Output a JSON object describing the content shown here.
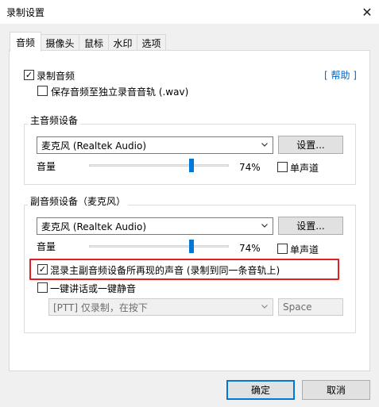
{
  "window": {
    "title": "录制设置",
    "close_glyph": "✕"
  },
  "tabs": [
    {
      "label": "音频",
      "active": true
    },
    {
      "label": "摄像头",
      "active": false
    },
    {
      "label": "鼠标",
      "active": false
    },
    {
      "label": "水印",
      "active": false
    },
    {
      "label": "选项",
      "active": false
    }
  ],
  "audio": {
    "record_audio": {
      "label": "录制音频",
      "checked": true
    },
    "help_link": "[ 帮助 ]",
    "separate_track": {
      "label": "保存音频至独立录音音轨 (.wav)",
      "checked": false
    },
    "primary": {
      "group_title": "主音频设备",
      "device": "麦克风 (Realtek Audio)",
      "settings_button": "设置...",
      "volume_label": "音量",
      "volume_value": "74%",
      "volume_level": 0.74,
      "mono": {
        "label": "单声道",
        "checked": false
      }
    },
    "secondary": {
      "group_title": "副音频设备（麦克风）",
      "device": "麦克风 (Realtek Audio)",
      "settings_button": "设置...",
      "volume_label": "音量",
      "volume_value": "74%",
      "volume_level": 0.74,
      "mono": {
        "label": "单声道",
        "checked": false
      }
    },
    "mix_secondary": {
      "label": "混录主副音频设备所再现的声音 (录制到同一条音轨上)",
      "checked": true,
      "highlight_color": "#e02020"
    },
    "ptt": {
      "label": "一键讲话或一键静音",
      "checked": false,
      "mode": "[PTT] 仅录制，在按下",
      "key": "Space"
    }
  },
  "footer": {
    "ok_button": "确定",
    "cancel_button": "取消"
  },
  "colors": {
    "accent": "#0078d7",
    "link": "#0066cc"
  }
}
